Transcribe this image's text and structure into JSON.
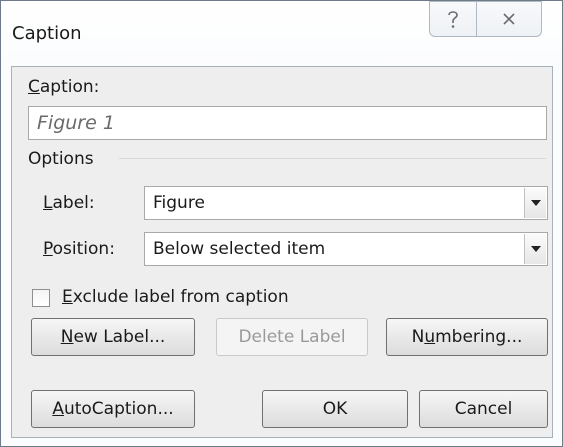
{
  "window": {
    "title": "Caption",
    "help_glyph": "?",
    "close_glyph": "X"
  },
  "caption": {
    "label_key": "C",
    "label_rest": "aption:",
    "value": "Figure 1"
  },
  "options": {
    "group_label": "Options",
    "label_field": {
      "label_key": "L",
      "label_rest": "abel:",
      "value": "Figure"
    },
    "position_field": {
      "label_key": "P",
      "label_rest": "osition:",
      "value": "Below selected item"
    },
    "exclude_checkbox": {
      "label_key": "E",
      "label_rest": "xclude label from caption",
      "checked": false
    }
  },
  "buttons": {
    "new_label": {
      "key": "N",
      "rest": "ew Label..."
    },
    "delete_label": {
      "text": "Delete Label",
      "enabled": false
    },
    "numbering": {
      "pre": "N",
      "key": "u",
      "rest": "mbering..."
    },
    "autocaption": {
      "key": "A",
      "rest": "utoCaption..."
    },
    "ok": {
      "text": "OK"
    },
    "cancel": {
      "text": "Cancel"
    }
  }
}
